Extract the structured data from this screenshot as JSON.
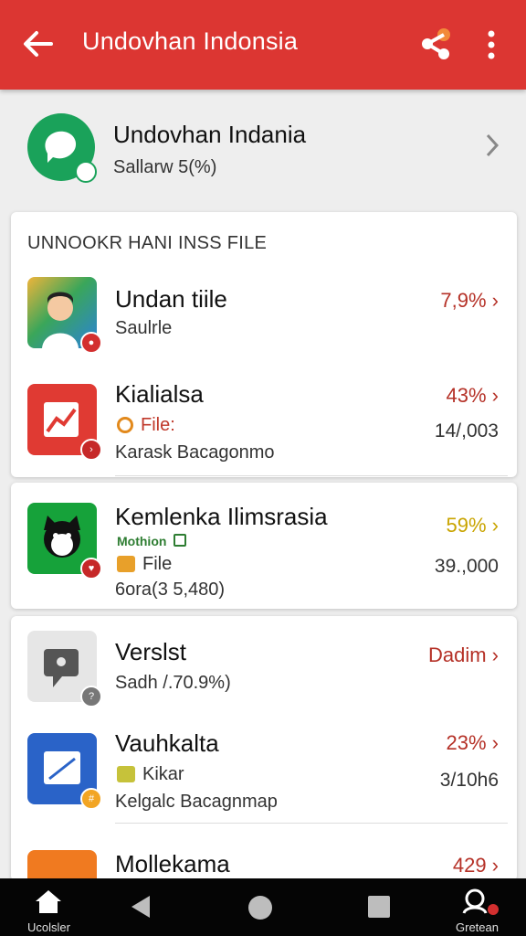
{
  "appbar": {
    "title": "Undovhan Indonsia",
    "back_icon": "arrow-left-icon",
    "share_icon": "share-icon",
    "more_icon": "more-vert-icon",
    "color": "#dc3632"
  },
  "entity": {
    "name": "Undovhan Indania",
    "meta": "Sallarw 5(%)"
  },
  "section": {
    "title": "UNNOOKR HANI INSS FILE"
  },
  "items": [
    {
      "title": "Undan tiile",
      "subtitle": "Saulrle",
      "percent": "7,9% ›",
      "percent_color": "#b53127"
    },
    {
      "title": "Kialialsa",
      "tag": "File:",
      "detail": "Karask Bacagonmo",
      "percent": "43% ›",
      "percent_color": "#b53127",
      "count": "14/,003"
    },
    {
      "title": "Kemlenka Ilimsrasia",
      "tag_small": "Mothion",
      "tag": "File",
      "detail": "6ora(3 5,480)",
      "percent": "59% ›",
      "percent_color": "#c9a400",
      "count": "39.,000"
    },
    {
      "title": "Verslst",
      "subtitle": "Sadh /.70.9%)",
      "percent": "Dadim ›",
      "percent_color": "#b53127"
    },
    {
      "title": "Vauhkalta",
      "tag": "Kikar",
      "detail": "Kelgalc Bacagnmap",
      "percent": "23% ›",
      "percent_color": "#b53127",
      "count": "3/10h6"
    },
    {
      "title": "Mollekama",
      "percent": "429 ›",
      "percent_color": "#b53127"
    }
  ],
  "navbar": {
    "left_label": "Ucolsler",
    "right_label": "Gretean"
  }
}
